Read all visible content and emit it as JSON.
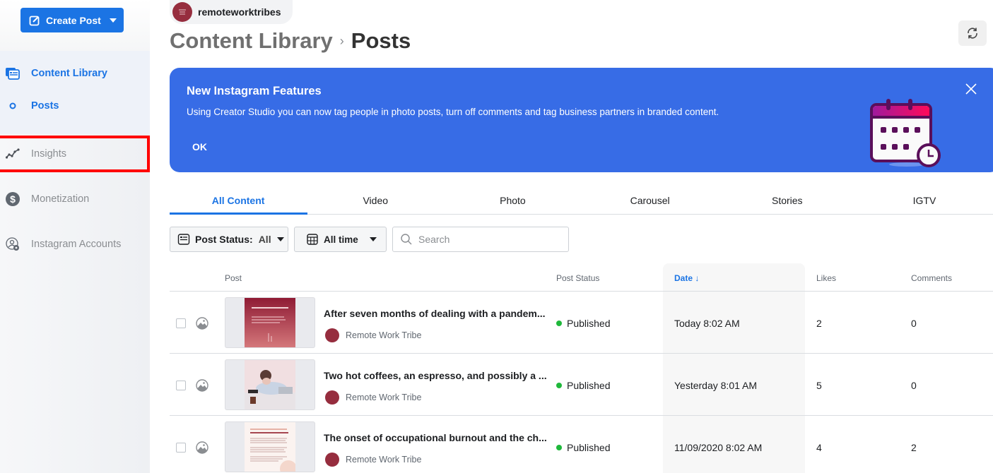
{
  "sidebar": {
    "create_button": "Create Post",
    "items": [
      {
        "label": "Content Library",
        "icon": "content-library-icon",
        "active": true
      },
      {
        "label": "Posts",
        "icon": "dot-icon",
        "active": true
      },
      {
        "label": "Insights",
        "icon": "insights-icon",
        "active": false
      },
      {
        "label": "Monetization",
        "icon": "dollar-icon",
        "active": false
      },
      {
        "label": "Instagram Accounts",
        "icon": "account-settings-icon",
        "active": false
      }
    ]
  },
  "header": {
    "account_name": "remoteworktribes",
    "breadcrumb_parent": "Content Library",
    "breadcrumb_current": "Posts"
  },
  "banner": {
    "title": "New Instagram Features",
    "body": "Using Creator Studio you can now tag people in photo posts, turn off comments and tag business partners in branded content.",
    "ok_label": "OK"
  },
  "tabs": [
    "All Content",
    "Video",
    "Photo",
    "Carousel",
    "Stories",
    "IGTV"
  ],
  "filters": {
    "status_label": "Post Status:",
    "status_value": "All",
    "time_value": "All time",
    "search_placeholder": "Search"
  },
  "table": {
    "columns": {
      "post": "Post",
      "status": "Post Status",
      "date": "Date ↓",
      "likes": "Likes",
      "comments": "Comments"
    },
    "rows": [
      {
        "title": "After seven months of dealing with a pandem...",
        "author": "Remote Work Tribe",
        "status": "Published",
        "date": "Today 8:02 AM",
        "likes": "2",
        "comments": "0"
      },
      {
        "title": "Two hot coffees, an espresso, and possibly a ...",
        "author": "Remote Work Tribe",
        "status": "Published",
        "date": "Yesterday 8:01 AM",
        "likes": "5",
        "comments": "0"
      },
      {
        "title": "The onset of occupational burnout and the ch...",
        "author": "Remote Work Tribe",
        "status": "Published",
        "date": "11/09/2020 8:02 AM",
        "likes": "4",
        "comments": "2"
      }
    ]
  },
  "colors": {
    "accent": "#1b74e4",
    "banner": "#376ce6",
    "published": "#1fb83b",
    "highlight": "#ff0000",
    "brand_avatar": "#962d3e"
  }
}
